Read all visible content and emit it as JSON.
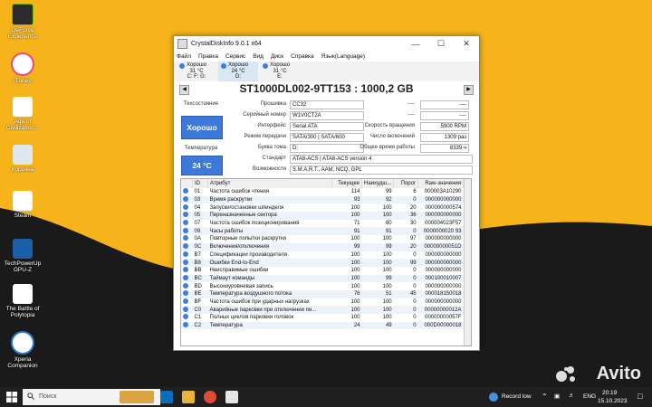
{
  "desktop": {
    "icons": [
      {
        "label": "GeForce Experience"
      },
      {
        "label": "iTunes"
      },
      {
        "label": "Age of Civilization..."
      },
      {
        "label": "Корзина"
      },
      {
        "label": "Steam"
      },
      {
        "label": "TechPowerUp GPU-Z"
      },
      {
        "label": "The Battle of Polytopia"
      },
      {
        "label": "Xperia Companion"
      }
    ]
  },
  "window": {
    "title": "CrystalDiskInfo 9.0.1 x64",
    "menu": [
      "Файл",
      "Правка",
      "Сервис",
      "Вид",
      "Диск",
      "Справка",
      "Язык(Language)"
    ],
    "drives": [
      {
        "status": "Хорошо",
        "temp": "31 °C",
        "letters": "C: F: G:"
      },
      {
        "status": "Хорошо",
        "temp": "24 °C",
        "letters": "D:"
      },
      {
        "status": "Хорошо",
        "temp": "31 °C",
        "letters": "E:"
      }
    ],
    "model": "ST1000DL002-9TT153 : 1000,2 GB",
    "status_label": "Техсостояние",
    "status_value": "Хорошо",
    "temp_label": "Температура",
    "temp_value": "24 °C",
    "fields": {
      "firmware_label": "Прошивка",
      "firmware": "CC32",
      "serial_label": "Серийный номер",
      "serial": "W1V0CT2A",
      "interface_label": "Интерфейс",
      "interface": "Serial ATA",
      "transfer_label": "Режим передачи",
      "transfer": "SATA/300 | SATA/600",
      "volume_label": "Буква тома",
      "volume": "D:",
      "standard_label": "Стандарт",
      "standard": "ATA8-ACS | ATA8-ACS version 4",
      "features_label": "Возможности",
      "features": "S.M.A.R.T., AAM, NCQ, GPL",
      "right_top1": "----",
      "right_top1b": "----",
      "right_top2": "----",
      "right_top2b": "----",
      "rotation_label": "Скорость вращения",
      "rotation": "5900 RPM",
      "power_count_label": "Число включений",
      "power_count": "1309 раз",
      "power_hours_label": "Общее время работы",
      "power_hours": "8339 ч"
    },
    "table": {
      "headers": [
        "ID",
        "Атрибут",
        "Текущее",
        "Наихудш...",
        "Порог",
        "Raw-значения"
      ],
      "rows": [
        [
          "01",
          "Частота ошибок чтения",
          "114",
          "99",
          "6",
          "000003A10290"
        ],
        [
          "03",
          "Время раскрутки",
          "93",
          "92",
          "0",
          "000000000000"
        ],
        [
          "04",
          "Запуски/остановки шпинделя",
          "100",
          "100",
          "20",
          "000000000574"
        ],
        [
          "05",
          "Переназначенные сектора",
          "100",
          "100",
          "36",
          "000000000000"
        ],
        [
          "07",
          "Частота ошибок позиционирования",
          "71",
          "60",
          "30",
          "000004023F57"
        ],
        [
          "09",
          "Часы работы",
          "91",
          "91",
          "0",
          "0000000020 93"
        ],
        [
          "0A",
          "Повторные попытки раскрутки",
          "100",
          "100",
          "97",
          "000000000000"
        ],
        [
          "0C",
          "Включения/отключения",
          "99",
          "99",
          "20",
          "00000000051D"
        ],
        [
          "B7",
          "Спецификации производителя",
          "100",
          "100",
          "0",
          "000000000000"
        ],
        [
          "B8",
          "Ошибки End-to-End",
          "100",
          "100",
          "99",
          "000000000000"
        ],
        [
          "BB",
          "Неисправимые ошибки",
          "100",
          "100",
          "0",
          "000000000000"
        ],
        [
          "BC",
          "Таймаут команды",
          "100",
          "99",
          "0",
          "000100010007"
        ],
        [
          "BD",
          "Высокоуровневая запись",
          "100",
          "100",
          "0",
          "000000000000"
        ],
        [
          "BE",
          "Температура воздушного потока",
          "76",
          "51",
          "45",
          "000018150018"
        ],
        [
          "BF",
          "Частота ошибок при ударных нагрузках",
          "100",
          "100",
          "0",
          "000000000000"
        ],
        [
          "C0",
          "Аварийные парковки при отключении пи...",
          "100",
          "100",
          "0",
          "00000000012A"
        ],
        [
          "C1",
          "Полных циклов парковки головок",
          "100",
          "100",
          "0",
          "00000000057F"
        ],
        [
          "C2",
          "Температура",
          "24",
          "49",
          "0",
          "000D00000018"
        ]
      ]
    }
  },
  "taskbar": {
    "search_placeholder": "Поиск",
    "record_label": "Record low",
    "lang": "ENG",
    "time": "20:19",
    "date": "15.10.2023"
  },
  "watermark": "Avito"
}
